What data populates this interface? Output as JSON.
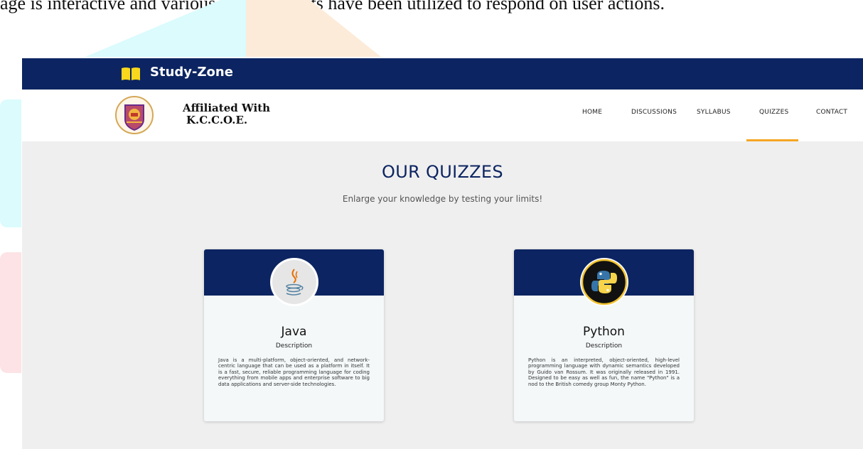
{
  "caption": "age is interactive and various CSS elements have been utilized to respond on user actions.",
  "header": {
    "brand": "Study-Zone",
    "brand_icon": "book-icon"
  },
  "navbar": {
    "logo_icon": "college-emblem-icon",
    "affiliation_line1": "Affiliated With",
    "affiliation_line2": "K.C.C.O.E.",
    "items": [
      {
        "label": "HOME"
      },
      {
        "label": "DISCUSSIONS"
      },
      {
        "label": "SYLLABUS"
      },
      {
        "label": "QUIZZES",
        "active": true
      },
      {
        "label": "CONTACT"
      }
    ]
  },
  "main": {
    "title": "OUR QUIZZES",
    "subtitle": "Enlarge your knowledge by testing your limits!",
    "cards": [
      {
        "title": "Java",
        "subtitle": "Description",
        "icon": "java-logo-icon",
        "description": "Java is a multi-platform, object-oriented, and network-centric language that can be used as a platform in itself. It is a fast, secure, reliable programming language for coding everything from mobile apps and enterprise software to big data applications and server-side technologies."
      },
      {
        "title": "Python",
        "subtitle": "Description",
        "icon": "python-logo-icon",
        "description": "Python is an interpreted, object-oriented, high-level programming language with dynamic semantics developed by Guido van Rossum. It was originally released in 1991. Designed to be easy as well as fun, the name \"Python\" is a nod to the British comedy group Monty Python."
      }
    ]
  },
  "colors": {
    "primary": "#0c2461",
    "accent": "#f5a623",
    "background": "#efefef",
    "card": "#f4f8f9"
  }
}
